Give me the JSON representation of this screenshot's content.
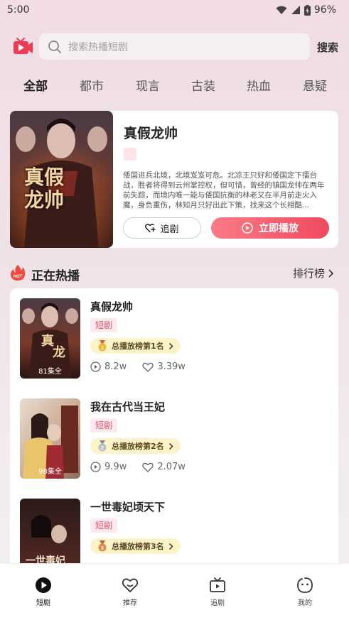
{
  "status": {
    "time": "5:00",
    "battery": "96%"
  },
  "search": {
    "placeholder": "搜索热播短剧",
    "button": "搜索"
  },
  "tabs": [
    {
      "label": "全部",
      "active": true
    },
    {
      "label": "都市"
    },
    {
      "label": "现言"
    },
    {
      "label": "古装"
    },
    {
      "label": "热血"
    },
    {
      "label": "悬疑"
    }
  ],
  "featured": {
    "title": "真假龙帅",
    "poster_text": "真假龙帅",
    "description": "倭国进兵北境，北境岌岌可危。北凉王只好和倭国定下擂台战，胜者将得到云州掌控权，但可惜，曾经的镇国龙帅在两年前失踪，而境内唯一能与倭国抗衡的林老又在半月前走火入魔，身负重伤，林知月只好出此下策，找来这个长相酷...",
    "follow_label": "追剧",
    "play_label": "立即播放"
  },
  "section": {
    "title": "正在热播",
    "link": "排行榜"
  },
  "items": [
    {
      "title": "真假龙帅",
      "tag": "短剧",
      "rank": "总播放榜第1名",
      "rank_num": "1",
      "episodes": "81集全",
      "plays": "8.2w",
      "likes": "3.39w"
    },
    {
      "title": "我在古代当王妃",
      "tag": "短剧",
      "rank": "总播放榜第2名",
      "rank_num": "2",
      "episodes": "98集全",
      "plays": "9.9w",
      "likes": "2.07w"
    },
    {
      "title": "一世毒妃顷天下",
      "tag": "短剧",
      "rank": "总播放榜第3名",
      "rank_num": "3",
      "episodes": "",
      "plays": "",
      "likes": ""
    }
  ],
  "nav": [
    {
      "label": "短剧",
      "active": true
    },
    {
      "label": "推荐"
    },
    {
      "label": "追剧"
    },
    {
      "label": "我的"
    }
  ],
  "colors": {
    "accent": "#f04a5e",
    "tag_bg": "#fdeaee",
    "rank_bg": "#fdf3c9"
  }
}
